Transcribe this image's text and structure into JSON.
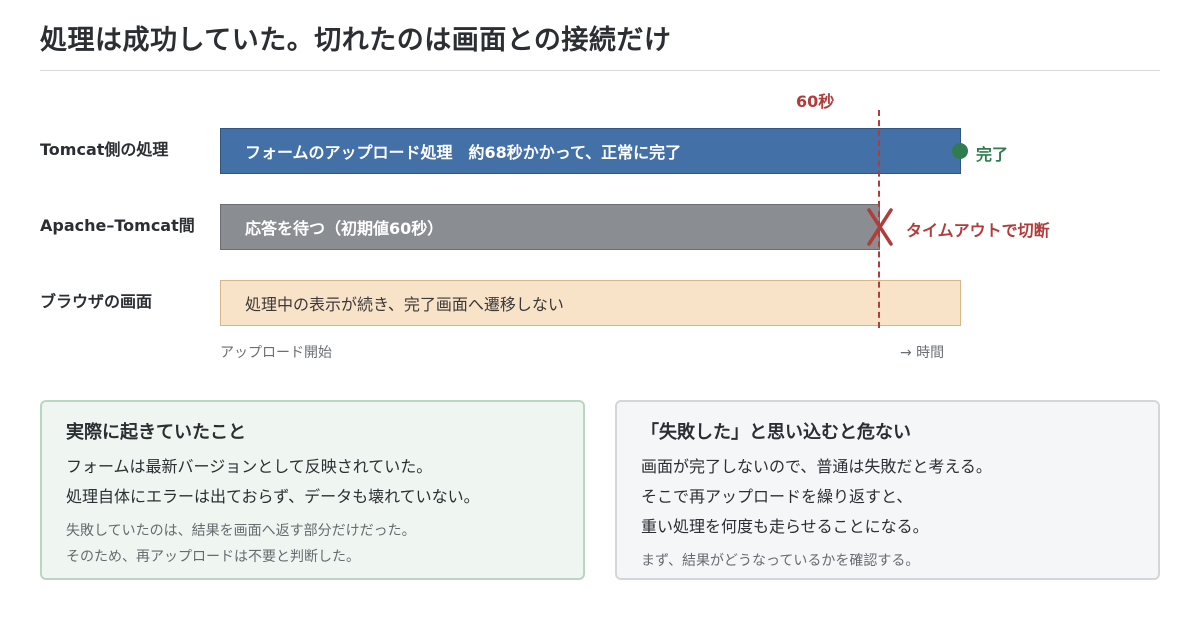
{
  "title": "処理は成功していた。切れたのは画面との接続だけ",
  "timeline": {
    "rows": [
      {
        "label": "Tomcat側の処理",
        "bar_text": "フォームのアップロード処理　約68秒かかって、正常に完了"
      },
      {
        "label": "Apache–Tomcat間",
        "bar_text": "応答を待つ（初期値60秒）"
      },
      {
        "label": "ブラウザの画面",
        "bar_text": "処理中の表示が続き、完了画面へ遷移しない"
      }
    ],
    "cutoff_label": "60秒",
    "done_label": "完了",
    "timeout_label": "タイムアウトで切断",
    "axis_start": "アップロード開始",
    "axis_end": "→ 時間",
    "colors": {
      "tomcat": "#4470a8",
      "apache": "#8a8d91",
      "browser": "#f8e3c8",
      "timeout": "#b23b3b",
      "done": "#2f7d4f"
    }
  },
  "cards": [
    {
      "title": "実際に起きていたこと",
      "lines": [
        "フォームは最新バージョンとして反映されていた。",
        "処理自体にエラーは出ておらず、データも壊れていない。"
      ],
      "notes": [
        "失敗していたのは、結果を画面へ返す部分だけだった。",
        "そのため、再アップロードは不要と判断した。"
      ]
    },
    {
      "title": "「失敗した」と思い込むと危ない",
      "lines": [
        "画面が完了しないので、普通は失敗だと考える。",
        "そこで再アップロードを繰り返すと、",
        "重い処理を何度も走らせることになる。"
      ],
      "notes": [
        "まず、結果がどうなっているかを確認する。"
      ]
    }
  ]
}
